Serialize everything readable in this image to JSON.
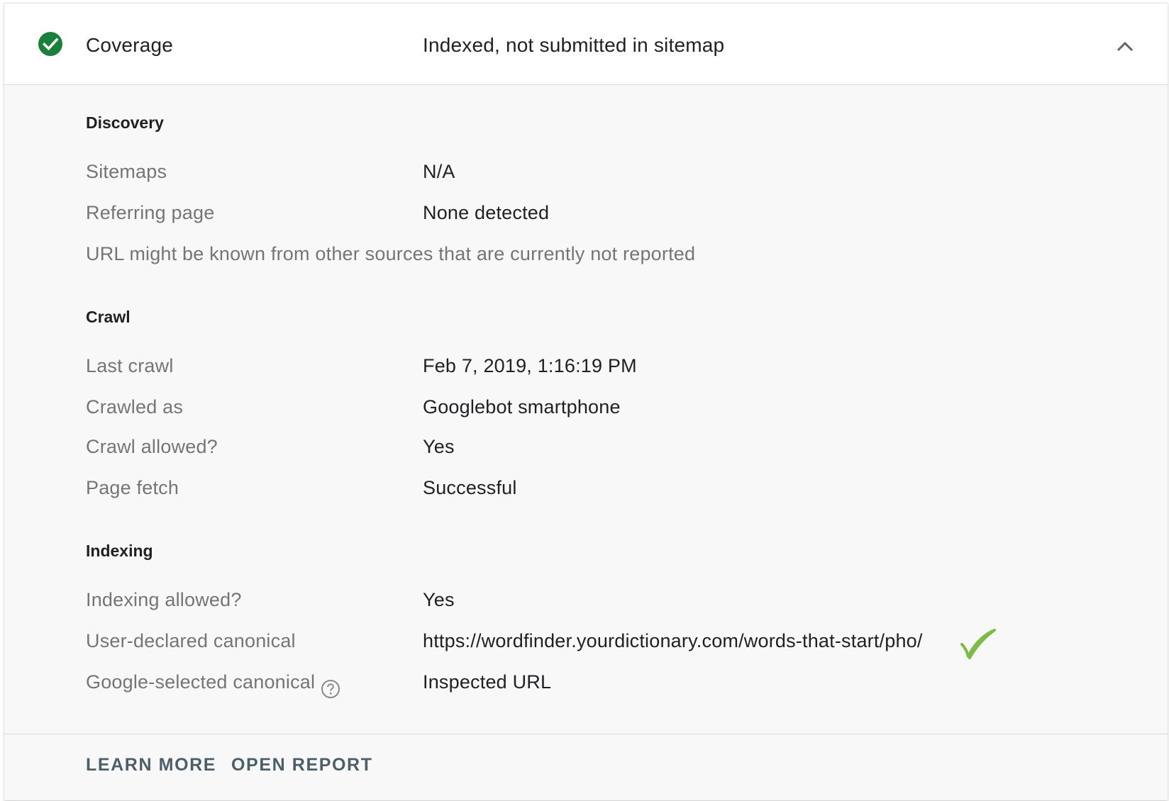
{
  "header": {
    "label": "Coverage",
    "value": "Indexed, not submitted in sitemap",
    "status_icon": "check-circle-icon",
    "status_color": "#188038",
    "collapse_icon": "chevron-up-icon"
  },
  "discovery": {
    "title": "Discovery",
    "rows": [
      {
        "label": "Sitemaps",
        "value": "N/A"
      },
      {
        "label": "Referring page",
        "value": "None detected"
      }
    ],
    "note": "URL might be known from other sources that are currently not reported"
  },
  "crawl": {
    "title": "Crawl",
    "rows": [
      {
        "label": "Last crawl",
        "value": "Feb 7, 2019, 1:16:19 PM"
      },
      {
        "label": "Crawled as",
        "value": "Googlebot smartphone"
      },
      {
        "label": "Crawl allowed?",
        "value": "Yes"
      },
      {
        "label": "Page fetch",
        "value": "Successful"
      }
    ]
  },
  "indexing": {
    "title": "Indexing",
    "rows": [
      {
        "label": "Indexing allowed?",
        "value": "Yes"
      },
      {
        "label": "User-declared canonical",
        "value": "https://wordfinder.yourdictionary.com/words-that-start/pho/"
      },
      {
        "label": "Google-selected canonical",
        "value": "Inspected URL"
      }
    ],
    "help_icon": "help-circle-icon",
    "annotation_icon": "checkmark-icon",
    "annotation_color": "#7cbb45"
  },
  "footer": {
    "learn_more": "LEARN MORE",
    "open_report": "OPEN REPORT"
  }
}
